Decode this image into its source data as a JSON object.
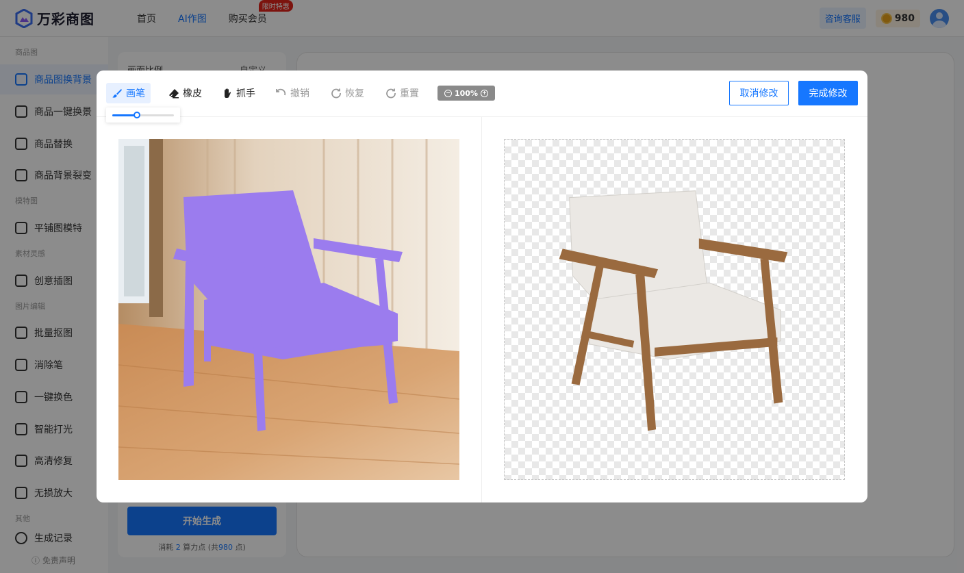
{
  "app": {
    "logo_text": "万彩商图",
    "nav": [
      {
        "label": "首页"
      },
      {
        "label": "AI作图"
      },
      {
        "label": "购买会员",
        "badge": "限时特惠"
      }
    ],
    "service_label": "咨询客服",
    "points": "980"
  },
  "sidebar": {
    "groups": [
      "商品图",
      "模特图",
      "素材灵感",
      "图片编辑",
      "其他"
    ],
    "items": [
      {
        "label": "商品图换背景",
        "icon": "image-swap-icon"
      },
      {
        "label": "商品一键换景",
        "icon": "scan-image-icon"
      },
      {
        "label": "商品替换",
        "icon": "replace-icon"
      },
      {
        "label": "商品背景裂变",
        "icon": "gallery-icon"
      },
      {
        "label": "平铺图模特",
        "icon": "shirt-icon"
      },
      {
        "label": "创意插图",
        "icon": "picture-icon"
      },
      {
        "label": "批量抠图",
        "icon": "cutout-icon"
      },
      {
        "label": "消除笔",
        "icon": "eraser-pen-icon"
      },
      {
        "label": "一键换色",
        "icon": "color-icon"
      },
      {
        "label": "智能打光",
        "icon": "bulb-icon"
      },
      {
        "label": "高清修复",
        "icon": "hd-icon"
      },
      {
        "label": "无损放大",
        "icon": "enlarge-icon"
      },
      {
        "label": "生成记录",
        "icon": "history-icon"
      }
    ],
    "disclaimer": "ⓘ 免责声明"
  },
  "form": {
    "ratio_label": "画面比例",
    "ratio_value": "自定义 ⌄",
    "generate_label": "开始生成",
    "cost_prefix": "消耗 ",
    "cost_points": "2",
    "cost_middle": " 算力点 (共",
    "cost_total": "980",
    "cost_suffix": " 点)"
  },
  "editor": {
    "tools": {
      "brush": "画笔",
      "eraser": "橡皮",
      "hand": "抓手",
      "undo": "撤销",
      "redo": "恢复",
      "reset": "重置"
    },
    "zoom": "100%",
    "brush_size": 0.4,
    "cancel_label": "取消修改",
    "done_label": "完成修改",
    "mask_color": "#9b7cee",
    "accent": "#1677ff"
  }
}
